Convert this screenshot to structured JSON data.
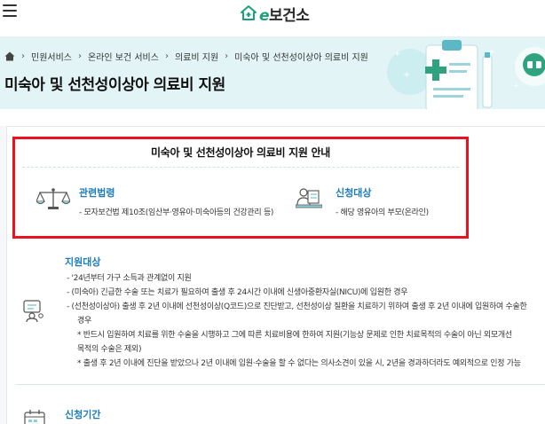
{
  "header": {
    "logo_mark": "e",
    "logo_text": "보건소",
    "menu_icon": "hamburger-icon"
  },
  "breadcrumb": {
    "items": [
      "민원서비스",
      "온라인 보건 서비스",
      "의료비 지원",
      "미숙아 및 선천성이상아 의료비 지원"
    ]
  },
  "page_title": "미숙아 및 선천성이상아 의료비 지원",
  "info": {
    "title": "미숙아 및 선천성이상아 의료비 지원 안내",
    "law": {
      "head": "관련법령",
      "desc": "- 모자보건법 제10조(임산부·영유아·미숙아등의 건강관리 등)",
      "icon": "scale-icon"
    },
    "target": {
      "head": "신청대상",
      "desc": "- 해당 영유아의 부모(온라인)",
      "icon": "person-desk-icon"
    }
  },
  "support": {
    "head": "지원대상",
    "icon": "consult-icon",
    "items": [
      "- '24년부터 가구 소득과 관계없이 지원",
      "- (미숙아) 긴급한 수술 또는 치료가 필요하여 출생 후 24시간 이내에 신생아중환자실(NICU)에 입원한 경우",
      "- (선천성이상아) 출생 후 2년 이내에 선천성이상(Q코드)으로 진단받고, 선천성이상 질환을 치료하기 위하여 출생 후 2년 이내에 입원하여 수술한",
      "경우",
      "* 반드시 입원하여 치료를 위한 수술을 시행하고 그에 따른 치료비용에 한하여 지원(기능상 문제로 인한 치료목적의 수술이 아닌 외모개선",
      "목적의 수술은 제외)",
      "* 출생 후 2년 이내에 진단을 받았으나 2년 이내에 입원·수술을 할 수 없다는 의사소견이 있을 시, 2년을 경과하더라도 예외적으로 인정 가능"
    ]
  },
  "period": {
    "head": "신청기간",
    "icon": "calendar-icon"
  },
  "colors": {
    "accent_blue": "#1d7cb8",
    "brand_green": "#1aa37a",
    "highlight_red": "#e8131f",
    "hero_bg": "#e3f4f6"
  }
}
